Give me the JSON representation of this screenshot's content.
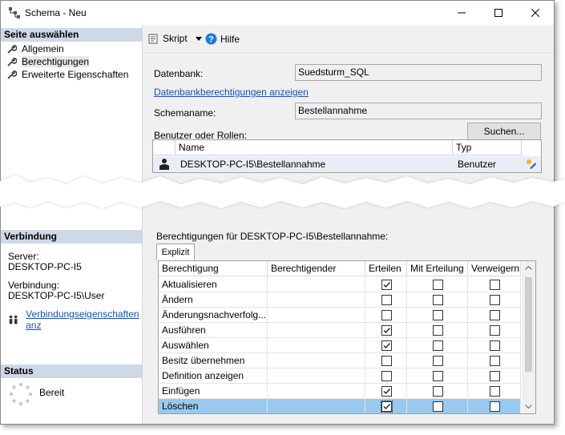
{
  "window": {
    "title": "Schema - Neu",
    "controls": [
      "minimize-icon",
      "maximize-icon",
      "close-icon"
    ]
  },
  "left_pane": {
    "select_page_header": "Seite auswählen",
    "pages": [
      {
        "label": "Allgemein",
        "icon": "wrench-icon"
      },
      {
        "label": "Berechtigungen",
        "icon": "wrench-icon"
      },
      {
        "label": "Erweiterte Eigenschaften",
        "icon": "wrench-icon"
      }
    ],
    "connection_header": "Verbindung",
    "server_label": "Server:",
    "server_value": "DESKTOP-PC-I5",
    "connection_label": "Verbindung:",
    "connection_value": "DESKTOP-PC-I5\\User",
    "connection_props_link": "Verbindungseigenschaften anz",
    "status_header": "Status",
    "status_value": "Bereit"
  },
  "toolbar": {
    "script_label": "Skript",
    "help_label": "Hilfe"
  },
  "form": {
    "database_label": "Datenbank:",
    "database_value": "Suedsturm_SQL",
    "db_permissions_link": "Datenbankberechtigungen anzeigen",
    "schema_name_label": "Schemaname:",
    "schema_name_value": "Bestellannahme",
    "owner_label": "Benutzer oder Rollen:",
    "search_button": "Suchen...",
    "users_grid": {
      "columns": [
        "Name",
        "Typ"
      ],
      "rows": [
        {
          "name": "DESKTOP-PC-I5\\Bestellannahme",
          "type": "Benutzer"
        }
      ]
    }
  },
  "permissions": {
    "title": "Berechtigungen für DESKTOP-PC-I5\\Bestellannahme:",
    "tab": "Explizit",
    "columns": [
      "Berechtigung",
      "Berechtigender",
      "Erteilen",
      "Mit Erteilung",
      "Verweigern"
    ],
    "rows": [
      {
        "name": "Aktualisieren",
        "grantor": "",
        "grant": true,
        "with_grant": false,
        "deny": false
      },
      {
        "name": "Ändern",
        "grantor": "",
        "grant": false,
        "with_grant": false,
        "deny": false
      },
      {
        "name": "Änderungsnachverfolg...",
        "grantor": "",
        "grant": false,
        "with_grant": false,
        "deny": false
      },
      {
        "name": "Ausführen",
        "grantor": "",
        "grant": true,
        "with_grant": false,
        "deny": false
      },
      {
        "name": "Auswählen",
        "grantor": "",
        "grant": true,
        "with_grant": false,
        "deny": false
      },
      {
        "name": "Besitz übernehmen",
        "grantor": "",
        "grant": false,
        "with_grant": false,
        "deny": false
      },
      {
        "name": "Definition anzeigen",
        "grantor": "",
        "grant": false,
        "with_grant": false,
        "deny": false
      },
      {
        "name": "Einfügen",
        "grantor": "",
        "grant": true,
        "with_grant": false,
        "deny": false
      },
      {
        "name": "Löschen",
        "grantor": "",
        "grant": true,
        "with_grant": false,
        "deny": false
      }
    ],
    "selected_row": 8
  }
}
